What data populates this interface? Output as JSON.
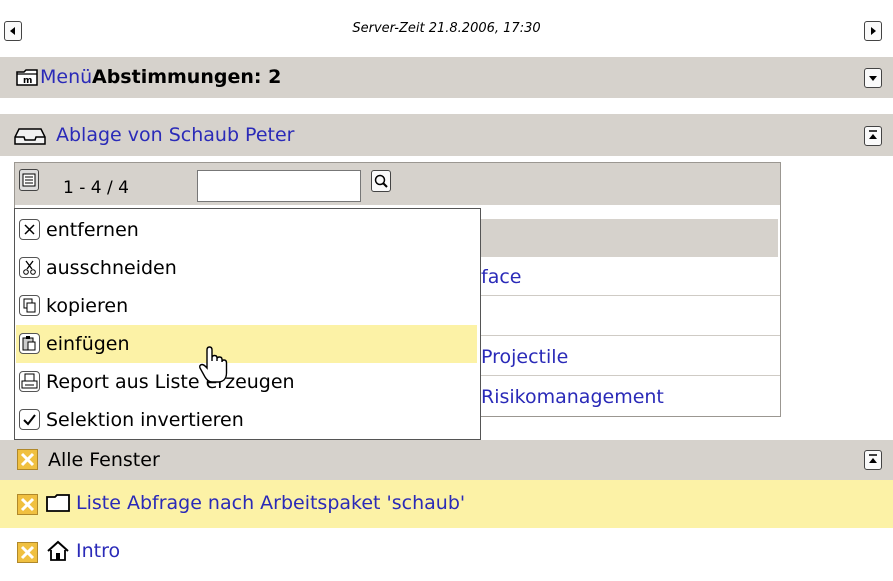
{
  "top_bar": {
    "server_time": "Server-Zeit 21.8.2006, 17:30"
  },
  "menu_bar": {
    "menu_link": "Menü",
    "title": "Abstimmungen: 2"
  },
  "ablage": {
    "title": "Ablage von Schaub Peter",
    "pager": "1 - 4 / 4",
    "search_value": "",
    "list_items": [
      "face",
      "Projectile",
      "Risikomanagement"
    ]
  },
  "context_menu": {
    "items": [
      {
        "label": "entfernen",
        "icon": "close-icon"
      },
      {
        "label": "ausschneiden",
        "icon": "scissors-icon"
      },
      {
        "label": "kopieren",
        "icon": "copy-icon"
      },
      {
        "label": "einfügen",
        "icon": "paste-icon"
      },
      {
        "label": "Report aus Liste erzeugen",
        "icon": "printer-icon"
      },
      {
        "label": "Selektion invertieren",
        "icon": "checkbox-icon"
      }
    ],
    "highlighted_index": 3
  },
  "windows": {
    "title": "Alle Fenster",
    "items": [
      {
        "label": "Liste Abfrage nach Arbeitspaket 'schaub'",
        "icon": "folder-icon",
        "active": true
      },
      {
        "label": "Intro",
        "icon": "home-icon",
        "active": false
      }
    ]
  },
  "colors": {
    "bar_gray": "#d6d2cc",
    "highlight_yellow": "#fcf2a6",
    "link_blue": "#2a2ab8",
    "close_box_orange": "#f0c040"
  }
}
